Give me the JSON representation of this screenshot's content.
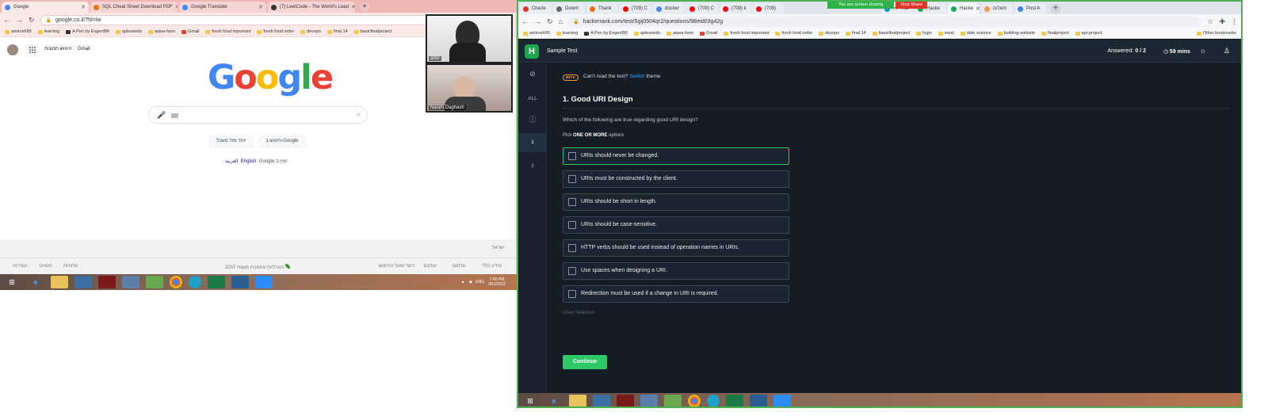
{
  "left_browser": {
    "tabs": [
      {
        "title": "Google",
        "color": "#4285f4"
      },
      {
        "title": "SQL Cheat Sheet Download PDF",
        "color": "#e8710a"
      },
      {
        "title": "Google Translate",
        "color": "#4285f4"
      },
      {
        "title": "(7) LeetCode - The World's Lead",
        "color": "#333333"
      }
    ],
    "url": "google.co.il/?hl=iw",
    "bookmarks": [
      "amirosh95",
      "learning",
      "A Pen by EvgenBR",
      "apleseeds",
      "aqwa-farm",
      "Gmail",
      "fresh food important",
      "fresh food order",
      "devops",
      "final 14",
      "basicfinalproject"
    ]
  },
  "google": {
    "top_links": {
      "gmail": "Gmail",
      "images": "חיפוש תמונות"
    },
    "logo_letters": [
      {
        "ch": "G",
        "color": "#4285f4"
      },
      {
        "ch": "o",
        "color": "#ea4335"
      },
      {
        "ch": "o",
        "color": "#fbbc05"
      },
      {
        "ch": "g",
        "color": "#4285f4"
      },
      {
        "ch": "l",
        "color": "#34a853"
      },
      {
        "ch": "e",
        "color": "#ea4335"
      }
    ],
    "buttons": {
      "search": "חיפוש ב-Google",
      "lucky": "יותר מזל משכל"
    },
    "language_line": {
      "prefix": "Google זמין ב:",
      "english": "English",
      "arabic": "العربية"
    },
    "footer": {
      "country": "ישראל",
      "links_right": [
        "מידע כללי",
        "פרסום",
        "עסקים",
        "כיצד פועל החיפוש"
      ],
      "carbon": "ניטרליות פחמנית משנת 2007",
      "links_left": [
        "פרטיות",
        "תנאים",
        "הגדרות"
      ]
    }
  },
  "video": {
    "participant_1": "amir",
    "participant_2": "Nasim Daghash"
  },
  "taskbar_left": {
    "time": "7:46 PM",
    "date": "4/11/2022",
    "lang": "ENG"
  },
  "right_browser": {
    "tabs": [
      "Oracle",
      "Downl",
      "Thank",
      "(709) C",
      "docker",
      "(709) C",
      "(709) k",
      "(709)",
      "HP Indi",
      "Hacke",
      "Hacke",
      "תשלום",
      "Post A"
    ],
    "active_tab_index": 10,
    "url": "hackerrank.com/test/5gij0504qr2/questions/9Beid03g42g",
    "share_banner": {
      "status": "You are screen sharing",
      "stop": "Stop Share"
    },
    "bookmarks": [
      "amirosh95",
      "learning",
      "A Pen by EvgenBR",
      "apleseeds",
      "aqwa-farm",
      "Gmail",
      "fresh food important",
      "fresh food order",
      "devops",
      "final 14",
      "basicfinalproject",
      "login",
      "meal",
      "date science",
      "building-website",
      "finalproject",
      "api-project",
      "Other bookmarks"
    ]
  },
  "hackerrank": {
    "logo": "H",
    "test_title": "Sample Test",
    "answered_label": "Answered:",
    "answered_value": "0 / 2",
    "timer": "59 mins",
    "rail": [
      "ALL",
      "1",
      "2"
    ],
    "beta_badge": "BETA",
    "beta_text": "Can't read the text?",
    "beta_switch": "Switch",
    "beta_theme": "theme",
    "question_title": "1. Good URI Design",
    "question_pre": "Which of the following are true regarding good",
    "question_em": "URI",
    "question_post": "design?",
    "pick_pre": "Pick",
    "pick_strong": "ONE OR MORE",
    "pick_post": "options",
    "options": [
      "URIs should never be changed.",
      "URIs must be constructed by the client.",
      "URIs should be short in length.",
      "URIs should be case-sensitive.",
      "HTTP verbs should be used instead of operation names in URIs.",
      "Use spaces when designing a URI.",
      "Redirection must be used if a change in URI is required."
    ],
    "highlighted_option": 0,
    "clear_selection": "Clear Selection",
    "continue": "Continue",
    "accent": "#2ec866"
  }
}
